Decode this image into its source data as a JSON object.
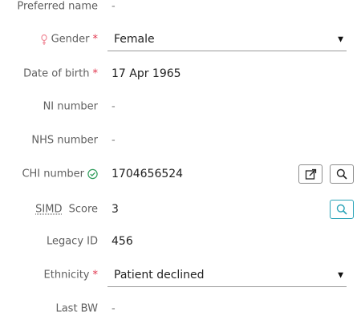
{
  "fields": {
    "preferred_name": {
      "label": "Preferred name",
      "value": "-"
    },
    "gender": {
      "label": "Gender",
      "required_mark": "*",
      "value": "Female",
      "caret": "▼",
      "icon": "gender-female-icon"
    },
    "dob": {
      "label": "Date of birth",
      "required_mark": "*",
      "value": "17 Apr 1965"
    },
    "ni_number": {
      "label": "NI number",
      "value": "-"
    },
    "nhs_number": {
      "label": "NHS number",
      "value": "-"
    },
    "chi_number": {
      "label": "CHI number",
      "value": "1704656524",
      "icon": "verified-check-icon"
    },
    "simd_score": {
      "label_abbr": "SIMD",
      "label_rest": " Score",
      "value": "3"
    },
    "legacy_id": {
      "label": "Legacy ID",
      "value": "456"
    },
    "ethnicity": {
      "label": "Ethnicity",
      "required_mark": "*",
      "value": "Patient declined",
      "caret": "▼"
    },
    "last_bw": {
      "label": "Last BW",
      "value": "-"
    }
  },
  "colors": {
    "required": "#e0324b",
    "verified": "#2e9b5a",
    "teal_button": "#2aa3b8"
  }
}
